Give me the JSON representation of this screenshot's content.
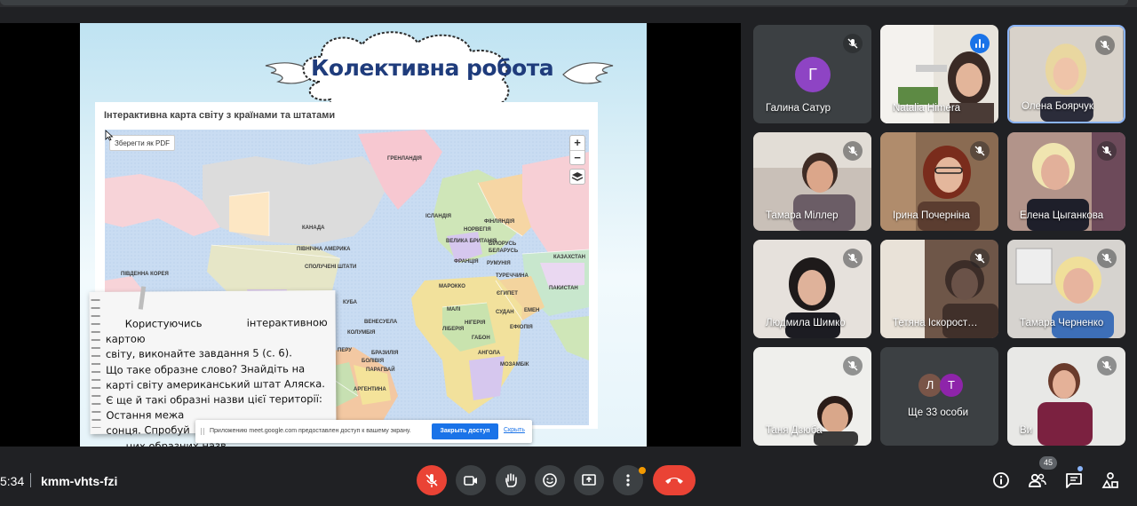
{
  "slide": {
    "title": "Колективна робота",
    "map_caption": "Інтерактивна карта світу з країнами та штатами",
    "pdf_button": "Зберегти як PDF",
    "zoom_in": "+",
    "zoom_out": "−",
    "map_labels": [
      "ГРЕНЛАНДІЯ",
      "ІСЛАНДІЯ",
      "ФІНЛЯНДІЯ",
      "НОРВЕГІЯ",
      "КАНАДА",
      "ВЕЛИКА БРИТАНІЯ",
      "БІЛОРУСЬ",
      "БЕЛАРУСЬ",
      "ФРАНЦІЯ",
      "РУМУНІЯ",
      "КАЗАХСТАН",
      "ТУРЕЧЧИНА",
      "ПІВНІЧНА АМЕРИКА",
      "СПОЛУЧЕНІ ШТАТИ",
      "МАРОККО",
      "ЄГИПЕТ",
      "ПАКИСТАН",
      "ПІВДЕННА КОРЕЯ",
      "КУБА",
      "МАЛІ",
      "СУДАН",
      "ВЕНЕСУЕЛА",
      "НІГЕРІЯ",
      "ЕМЕН",
      "КОЛУМБІЯ",
      "ЛІБЕРІЯ",
      "ЕФІОПІЯ",
      "ПЕРУ",
      "ГАБОН",
      "БРАЗИЛІЯ",
      "АНГОЛА",
      "БОЛІВІЯ",
      "МОЗАМБІК",
      "ПАРАГВАЙ",
      "АРГЕНТИНА"
    ],
    "task_lines": [
      "Користуючись інтерактивною картою",
      "світу, виконайте завдання 5 (с. 6).",
      "Що таке образне слово? Знайдіть на",
      "карті світу американський штат Аляска.",
      "Є ще й такі образні назви цієї території:",
      "Остання межа",
      "сонця. Спробуй",
      "цих образних назв."
    ],
    "share_banner": {
      "text": "Приложению meet.google.com предоставлен доступ к вашему экрану.",
      "stop_button": "Закрыть доступ",
      "hide_link": "Скрыть"
    }
  },
  "participants": [
    {
      "name": "Галина Сатур",
      "avatar": "Г",
      "avatar_color": "#8e44c4",
      "muted": true
    },
    {
      "name": "Natalia Himera",
      "muted": false,
      "speaking": true
    },
    {
      "name": "Олена Боярчук",
      "muted": true,
      "active": true
    },
    {
      "name": "Тамара Міллер",
      "muted": true
    },
    {
      "name": "Ірина Почерніна",
      "muted": true
    },
    {
      "name": "Елена Цыганкова",
      "muted": true
    },
    {
      "name": "Людмила Шимко",
      "muted": true
    },
    {
      "name": "Тетяна Іскорост…",
      "muted": true
    },
    {
      "name": "Тамара Черненко",
      "muted": true
    },
    {
      "name": "Таня Дзюба",
      "muted": true
    },
    {
      "name": "Ще 33 особи",
      "avatars": [
        "Л",
        "Т"
      ],
      "avatar_colors": [
        "#795548",
        "#8e24aa"
      ]
    },
    {
      "name": "Ви",
      "muted": true
    }
  ],
  "bottom_bar": {
    "time": "5:34",
    "meeting_code": "kmm-vhts-fzi",
    "participants_count": "45",
    "colors": {
      "danger": "#ea4335",
      "control": "#3c4043",
      "badge": "#f29900"
    }
  },
  "icons": [
    "mic-off-icon",
    "camera-icon",
    "raise-hand-icon",
    "emoji-icon",
    "present-icon",
    "more-options-icon",
    "hang-up-icon",
    "info-icon",
    "people-icon",
    "chat-icon",
    "activities-icon",
    "layers-icon"
  ]
}
